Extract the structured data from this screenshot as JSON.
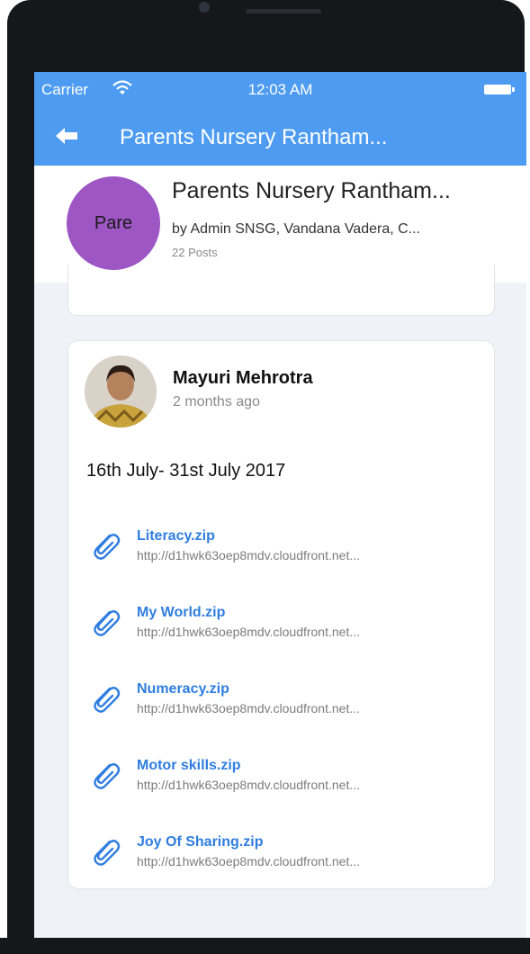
{
  "status_bar": {
    "carrier": "Carrier",
    "time": "12:03 AM"
  },
  "nav": {
    "title": "Parents Nursery Rantham..."
  },
  "group": {
    "avatar_text": "Pare",
    "avatar_color": "#9d56c4",
    "title": "Parents Nursery Rantham...",
    "members": "by Admin SNSG, Vandana Vadera, C...",
    "posts": "22 Posts"
  },
  "post": {
    "author": "Mayuri Mehrotra",
    "time": "2 months ago",
    "text": "16th July- 31st July 2017",
    "attachments": [
      {
        "name": "Literacy.zip",
        "url": "http://d1hwk63oep8mdv.cloudfront.net..."
      },
      {
        "name": "My World.zip",
        "url": "http://d1hwk63oep8mdv.cloudfront.net..."
      },
      {
        "name": "Numeracy.zip",
        "url": "http://d1hwk63oep8mdv.cloudfront.net..."
      },
      {
        "name": "Motor skills.zip",
        "url": "http://d1hwk63oep8mdv.cloudfront.net..."
      },
      {
        "name": "Joy Of Sharing.zip",
        "url": "http://d1hwk63oep8mdv.cloudfront.net..."
      }
    ]
  },
  "icons": {
    "status": [
      "wifi-icon",
      "battery-icon"
    ],
    "nav": "back-arrow-icon",
    "attachment": "paperclip-icon"
  },
  "colors": {
    "accent": "#4e9cf1",
    "link": "#2f7de0",
    "background": "#f1f2f7"
  }
}
